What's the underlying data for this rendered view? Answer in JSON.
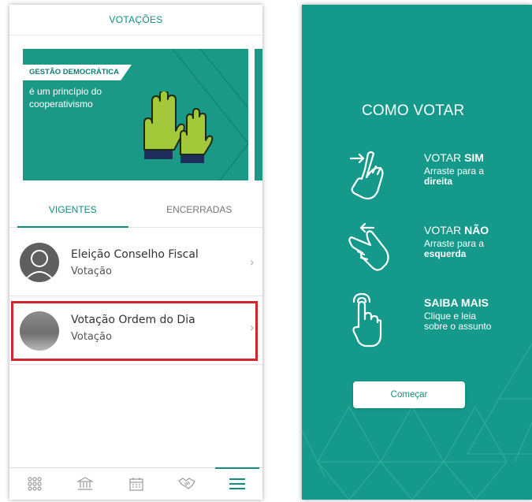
{
  "left_screen": {
    "header_title": "VOTAÇÕES",
    "banner": {
      "tag": "GESTÃO DEMOCRÁTICA",
      "subtitle": "é um princípio do cooperativismo",
      "bg_color": "#1a9a86"
    },
    "tabs": [
      {
        "label": "VIGENTES",
        "active": true
      },
      {
        "label": "ENCERRADAS",
        "active": false
      }
    ],
    "items": [
      {
        "title": "Eleição Conselho Fiscal",
        "subtitle": "Votação",
        "avatar": "user-placeholder-icon"
      },
      {
        "title": "Votação Ordem do Dia",
        "subtitle": "Votação",
        "avatar": "photo-thumbnail",
        "highlighted": true
      }
    ],
    "bottom_nav": [
      "apps-grid-icon",
      "bank-icon",
      "calendar-icon",
      "handshake-icon",
      "menu-icon"
    ],
    "accent_color": "#0f8f80",
    "highlight_color": "#d3262c"
  },
  "right_screen": {
    "title": "COMO VOTAR",
    "instructions": [
      {
        "heading_plain": "VOTAR ",
        "heading_bold": "SIM",
        "line1": "Arraste para a",
        "line2_bold": "direita",
        "icon": "swipe-right-icon"
      },
      {
        "heading_plain": "VOTAR ",
        "heading_bold": "NÃO",
        "line1": "Arraste para a",
        "line2_bold": "esquerda",
        "icon": "swipe-left-icon"
      },
      {
        "heading_plain": "",
        "heading_bold": "SAIBA MAIS",
        "line1": "Clique e leia",
        "line2": "sobre o assunto",
        "icon": "tap-icon"
      }
    ],
    "start_button": "Começar",
    "bg_color": "#15998a"
  }
}
